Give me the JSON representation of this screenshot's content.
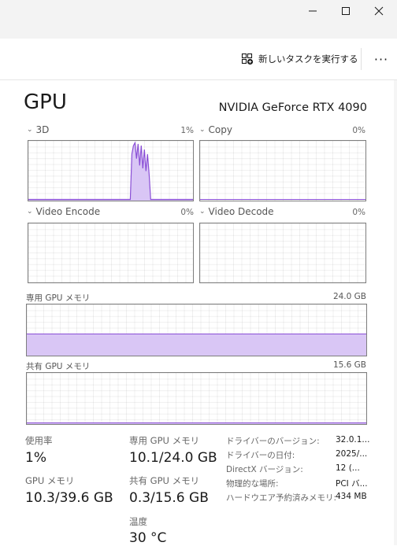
{
  "window": {
    "minimize_glyph": "—",
    "maximize_glyph": "☐",
    "close_glyph": "✕"
  },
  "toolbar": {
    "new_task_label": "新しいタスクを実行する",
    "new_task_icon": "new-task-icon",
    "more_label": "···"
  },
  "header": {
    "title": "GPU",
    "device_name": "NVIDIA GeForce RTX 4090"
  },
  "engines": [
    {
      "label": "3D",
      "percent": "1%"
    },
    {
      "label": "Copy",
      "percent": "0%"
    },
    {
      "label": "Video Encode",
      "percent": "0%"
    },
    {
      "label": "Video Decode",
      "percent": "0%"
    }
  ],
  "memory_graphs": {
    "dedicated": {
      "label": "専用 GPU メモリ",
      "max": "24.0 GB",
      "usage_fraction": 0.42
    },
    "shared": {
      "label": "共有 GPU メモリ",
      "max": "15.6 GB",
      "usage_fraction": 0.02
    }
  },
  "stats": {
    "utilization": {
      "label": "使用率",
      "value": "1%"
    },
    "dedicated": {
      "label": "専用 GPU メモリ",
      "value": "10.1/24.0 GB"
    },
    "gpu_memory": {
      "label": "GPU メモリ",
      "value": "10.3/39.6 GB"
    },
    "shared": {
      "label": "共有 GPU メモリ",
      "value": "0.3/15.6 GB"
    },
    "temperature": {
      "label": "温度",
      "value": "30 °C"
    }
  },
  "info": [
    {
      "label": "ドライバーのバージョン:",
      "value": "32.0.1..."
    },
    {
      "label": "ドライバーの日付:",
      "value": "2025/..."
    },
    {
      "label": "DirectX バージョン:",
      "value": "12 (..."
    },
    {
      "label": "物理的な場所:",
      "value": "PCI バ..."
    },
    {
      "label": "ハードウエア予約済みメモリ:",
      "value": "434 MB"
    }
  ],
  "colors": {
    "accent": "#8a4fd6",
    "fill": "#d9c6f5",
    "grid": "#e8e8e8",
    "border": "#7e7e7e"
  },
  "graph_3d_series": [
    0,
    0,
    0,
    0,
    0,
    0,
    0,
    0,
    0,
    0,
    0,
    0,
    0,
    0,
    0,
    0,
    0,
    0,
    0,
    0,
    0,
    0,
    0,
    0,
    0,
    0,
    0,
    0,
    0,
    0,
    0,
    0,
    0,
    0,
    0,
    0,
    0,
    0,
    0,
    0,
    0,
    0,
    0,
    0,
    0,
    0,
    0,
    0,
    0,
    0,
    0,
    0,
    0,
    0,
    0,
    0,
    0,
    0,
    0,
    0,
    0,
    0,
    0,
    0,
    0,
    0,
    80,
    95,
    100,
    72,
    98,
    60,
    95,
    55,
    88,
    50,
    80,
    45,
    0,
    0,
    0,
    0,
    0,
    0,
    0,
    0,
    0,
    0,
    0,
    0,
    0,
    0,
    0,
    0,
    0,
    0,
    0,
    0,
    0,
    0,
    0,
    0,
    0,
    0,
    0,
    0
  ]
}
